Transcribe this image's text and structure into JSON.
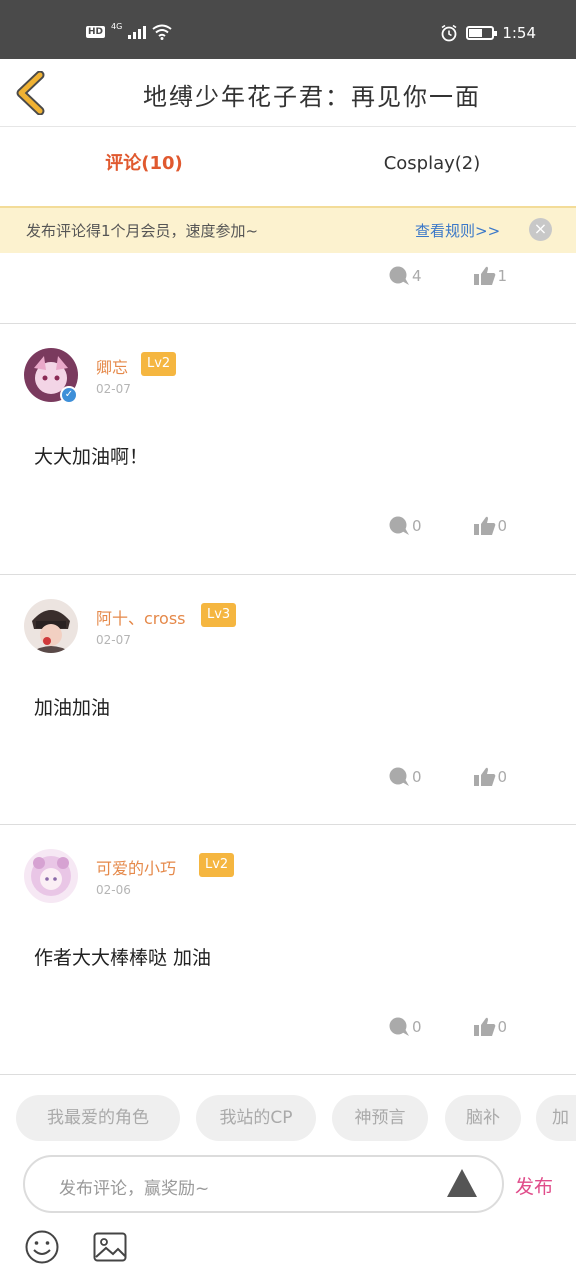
{
  "status_bar": {
    "hd": "HD",
    "network": "4G",
    "time": "1:54",
    "battery_level": 0.6
  },
  "header": {
    "title": "地缚少年花子君：再见你一面",
    "back_icon": "chevron-left-icon",
    "accent_color": "#f0b233"
  },
  "tabs": [
    {
      "label": "评论(10)",
      "active": true
    },
    {
      "label": "Cosplay(2)",
      "active": false
    }
  ],
  "notice": {
    "text": "发布评论得1个月会员，速度参加~",
    "link": "查看规则>>",
    "close_icon": "close-icon"
  },
  "partial_item": {
    "comments": "4",
    "likes": "1"
  },
  "comments": [
    {
      "user": "卿忘",
      "level": "Lv2",
      "date": "02-07",
      "text": "大大加油啊！",
      "comments": "0",
      "likes": "0",
      "verified": true
    },
    {
      "user": "阿十、cross",
      "level": "Lv3",
      "date": "02-07",
      "text": "加油加油",
      "comments": "0",
      "likes": "0",
      "verified": false
    },
    {
      "user": "可爱的小巧",
      "level": "Lv2",
      "date": "02-06",
      "text": "作者大大棒棒哒  加油",
      "comments": "0",
      "likes": "0",
      "verified": false
    }
  ],
  "chips": [
    "我最爱的角色",
    "我站的CP",
    "神预言",
    "脑补",
    "加"
  ],
  "composer": {
    "placeholder": "发布评论，赢奖励~",
    "publish_label": "发布",
    "emoji_icon": "smiley-icon",
    "image_icon": "image-icon"
  }
}
